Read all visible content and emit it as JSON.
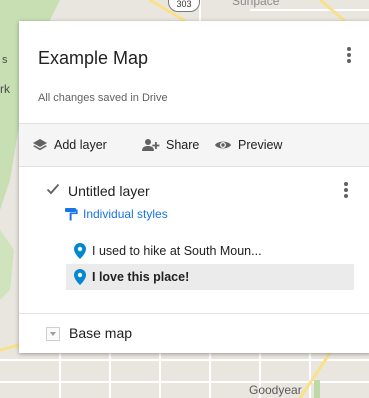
{
  "map": {
    "labels": {
      "top_road": "Sunpace",
      "shield": "303",
      "left_fragment_1": "s",
      "left_fragment_2": "rk",
      "city": "Goodyear"
    },
    "colors": {
      "land": "#e9e6df",
      "park": "#c8dfb4",
      "road_major": "#fbe08a",
      "road_minor": "#ffffff"
    }
  },
  "panel": {
    "title": "Example Map",
    "save_status": "All changes saved in Drive",
    "options_icon": "more-vert-icon",
    "toolbar": {
      "add_layer": {
        "label": "Add layer",
        "icon": "layers-icon"
      },
      "share": {
        "label": "Share",
        "icon": "person-add-icon"
      },
      "preview": {
        "label": "Preview",
        "icon": "eye-icon"
      }
    },
    "layer": {
      "checked": true,
      "title": "Untitled layer",
      "style_label": "Individual styles",
      "style_icon": "paint-roller-icon",
      "features": [
        {
          "label": "I used to hike at South Moun...",
          "icon": "place-pin-icon",
          "selected": false
        },
        {
          "label": "I love this place!",
          "icon": "place-pin-icon",
          "selected": true
        }
      ]
    },
    "base_map": {
      "label": "Base map",
      "expand_icon": "chevron-down-icon"
    },
    "accent_color": "#1a73e8",
    "pin_color": "#0288d1"
  }
}
